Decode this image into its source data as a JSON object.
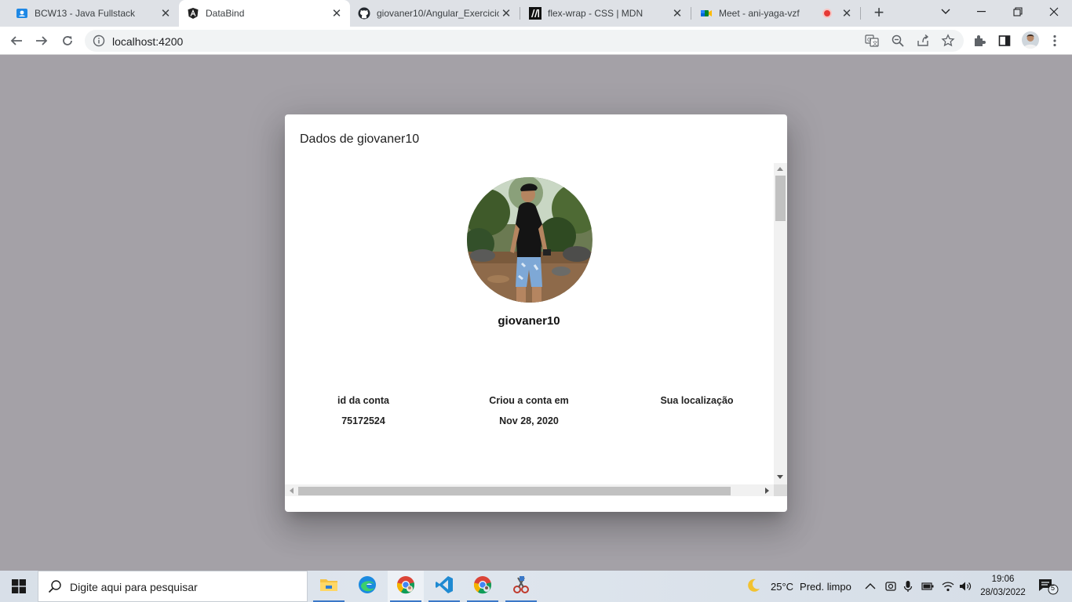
{
  "browser": {
    "tabs": [
      {
        "title": "BCW13 - Java Fullstack",
        "icon": "classroom-icon",
        "active": false
      },
      {
        "title": "DataBind",
        "icon": "angular-icon",
        "active": true
      },
      {
        "title": "giovaner10/Angular_Exercicio",
        "icon": "github-icon",
        "active": false
      },
      {
        "title": "flex-wrap - CSS | MDN",
        "icon": "mdn-icon",
        "active": false
      },
      {
        "title": "Meet - ani-yaga-vzf",
        "icon": "meet-icon",
        "active": false
      }
    ],
    "new_tab_symbol": "+",
    "url": "localhost:4200"
  },
  "dialog": {
    "title": "Dados de giovaner10",
    "username": "giovaner10",
    "columns": [
      {
        "label": "id da conta",
        "value": "75172524"
      },
      {
        "label": "Criou a conta em",
        "value": "Nov 28, 2020"
      },
      {
        "label": "Sua localização",
        "value": ""
      }
    ]
  },
  "taskbar": {
    "search_placeholder": "Digite aqui para pesquisar",
    "weather": {
      "temp": "25°C",
      "desc": "Pred. limpo"
    },
    "time": "19:06",
    "date": "28/03/2022",
    "notifications": "5"
  },
  "colors": {
    "page_backdrop": "#a4a1a7",
    "tab_strip": "#dee1e6",
    "accent": "#1a73e8"
  }
}
